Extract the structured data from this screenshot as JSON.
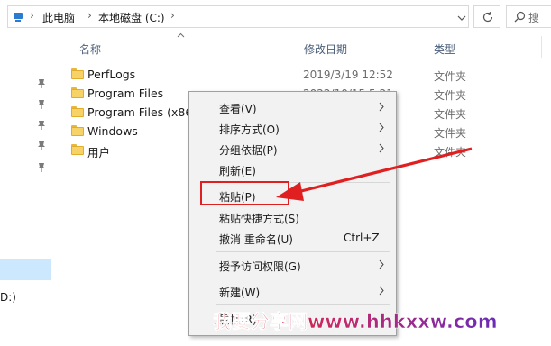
{
  "address_bar": {
    "breadcrumbs": [
      "此电脑",
      "本地磁盘 (C:)"
    ],
    "separator": "›",
    "refresh_icon": "refresh-icon",
    "search_icon": "search-icon",
    "search_placeholder": "搜"
  },
  "nav_pane": {
    "pinned_icon": "pin-icon",
    "drive_label": "D:)"
  },
  "columns": {
    "name": "名称",
    "date": "修改日期",
    "type": "类型"
  },
  "files": [
    {
      "name": "PerfLogs",
      "date": "2019/3/19 12:52",
      "type": "文件夹"
    },
    {
      "name": "Program Files",
      "date": "2022/10/15 5:21",
      "type": "文件夹"
    },
    {
      "name": "Program Files (x86)",
      "date": "",
      "type": "文件夹"
    },
    {
      "name": "Windows",
      "date": "",
      "type": "文件夹"
    },
    {
      "name": "用户",
      "date": "",
      "type": "文件夹"
    }
  ],
  "context_menu": {
    "view": "查看(V)",
    "sort": "排序方式(O)",
    "group": "分组依据(P)",
    "refresh": "刷新(E)",
    "paste": "粘贴(P)",
    "paste_shortcut": "粘贴快捷方式(S)",
    "undo": "撤消 重命名(U)",
    "undo_shortcut": "Ctrl+Z",
    "grant_access": "授予访问权限(G)",
    "new": "新建(W)",
    "properties": "属性(R)"
  },
  "watermark": "我要分享网www.hhkxxw.com",
  "colors": {
    "highlight_red": "#e02020",
    "selection_blue": "#cce8ff",
    "folder_yellow": "#f7d266",
    "watermark_red": "#e8202a",
    "watermark_purple": "#6a2bb8"
  }
}
